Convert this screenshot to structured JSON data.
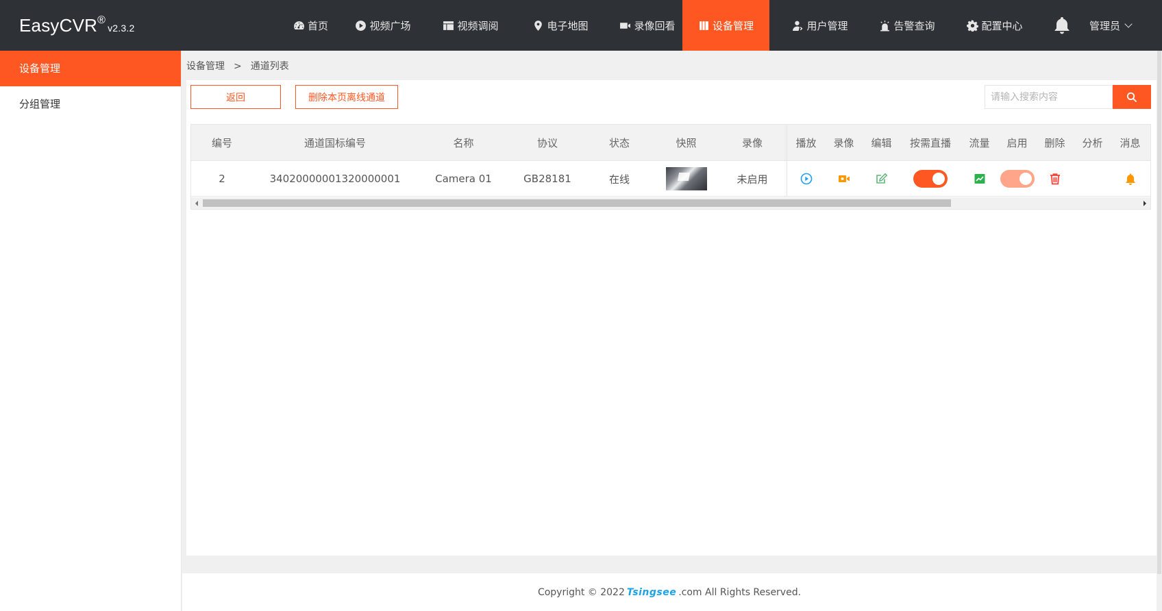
{
  "app": {
    "name": "EasyCVR",
    "reg": "®",
    "version": "v2.3.2"
  },
  "nav": [
    {
      "label": "首页",
      "icon": "dashboard-icon"
    },
    {
      "label": "视频广场",
      "icon": "play-circle-icon"
    },
    {
      "label": "视频调阅",
      "icon": "layout-icon"
    },
    {
      "label": "电子地图",
      "icon": "map-pin-icon"
    },
    {
      "label": "录像回看",
      "icon": "video-camera-icon"
    },
    {
      "label": "设备管理",
      "icon": "device-icon",
      "active": true
    },
    {
      "label": "用户管理",
      "icon": "user-icon"
    },
    {
      "label": "告警查询",
      "icon": "alarm-icon"
    },
    {
      "label": "配置中心",
      "icon": "gear-icon"
    }
  ],
  "user": {
    "label": "管理员"
  },
  "sidebar": {
    "items": [
      {
        "label": "设备管理",
        "active": true
      },
      {
        "label": "分组管理"
      }
    ]
  },
  "breadcrumb": {
    "parent": "设备管理",
    "sep": ">",
    "current": "通道列表"
  },
  "toolbar": {
    "back_label": "返回",
    "delete_offline_label": "删除本页离线通道",
    "search_placeholder": "请输入搜索内容"
  },
  "table": {
    "headers": [
      "编号",
      "通道国标编号",
      "名称",
      "协议",
      "状态",
      "快照",
      "录像",
      "播放",
      "录像",
      "编辑",
      "按需直播",
      "流量",
      "启用",
      "删除",
      "分析",
      "消息"
    ],
    "rows": [
      {
        "id": "2",
        "gb_code": "34020000001320000001",
        "name": "Camera 01",
        "protocol": "GB28181",
        "status": "在线",
        "recording": "未启用",
        "on_demand": true,
        "enabled": true
      }
    ]
  },
  "colors": {
    "accent": "#ff5722",
    "topbar": "#2e3236",
    "online": "#2bb24c",
    "play": "#1e9fff",
    "record": "#ff9800",
    "edit": "#5fb878",
    "delete": "#ff3b30",
    "toggle_light": "#ffa58a"
  },
  "footer": {
    "prefix": "Copyright © 2022",
    "brand": "Tsingsee",
    "suffix": ".com All Rights Reserved."
  }
}
